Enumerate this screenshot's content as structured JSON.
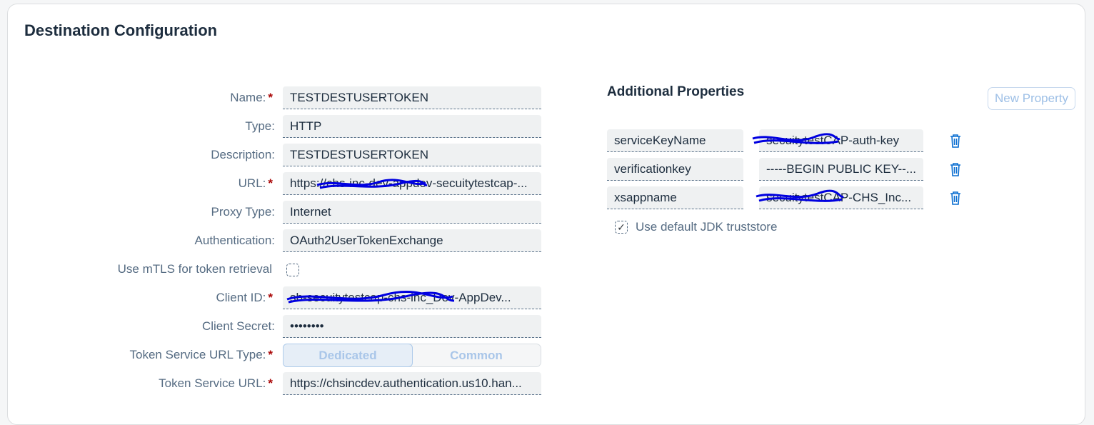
{
  "page": {
    "title": "Destination Configuration"
  },
  "form": {
    "name": {
      "label": "Name:",
      "required": "*",
      "value": "TESTDESTUSERTOKEN"
    },
    "type": {
      "label": "Type:",
      "value": "HTTP"
    },
    "description": {
      "label": "Description:",
      "value": "TESTDESTUSERTOKEN"
    },
    "url": {
      "label": "URL:",
      "required": "*",
      "value": "https://chs-inc-dev-appdev-secuitytestcap-..."
    },
    "proxy_type": {
      "label": "Proxy Type:",
      "value": "Internet"
    },
    "authentication": {
      "label": "Authentication:",
      "value": "OAuth2UserTokenExchange"
    },
    "mtls": {
      "label": "Use mTLS for token retrieval",
      "checked": false
    },
    "client_id": {
      "label": "Client ID:",
      "required": "*",
      "value": "sb-secuitytestcap-chs-inc_Dev-AppDev..."
    },
    "client_secret": {
      "label": "Client Secret:",
      "value": "••••••••"
    },
    "token_service_url_type": {
      "label": "Token Service URL Type:",
      "required": "*",
      "options": [
        "Dedicated",
        "Common"
      ],
      "selected": "Dedicated"
    },
    "token_service_url": {
      "label": "Token Service URL:",
      "required": "*",
      "value": "https://chsincdev.authentication.us10.han..."
    }
  },
  "additional_properties": {
    "title": "Additional Properties",
    "new_property_label": "New Property",
    "items": [
      {
        "key": "serviceKeyName",
        "value": "secuitytestCAP-auth-key"
      },
      {
        "key": "verificationkey",
        "value": "-----BEGIN PUBLIC KEY--..."
      },
      {
        "key": "xsappname",
        "value": "secuitytestCAP-CHS_Inc..."
      }
    ],
    "jdk_truststore": {
      "label": "Use default JDK truststore",
      "checked": true,
      "check_glyph": "✓"
    }
  },
  "icons": {
    "delete": "trash-icon",
    "checkbox_check": "check-icon"
  },
  "colors": {
    "accent": "#0064d9",
    "required": "#aa0808",
    "scribble": "#0000e0"
  }
}
